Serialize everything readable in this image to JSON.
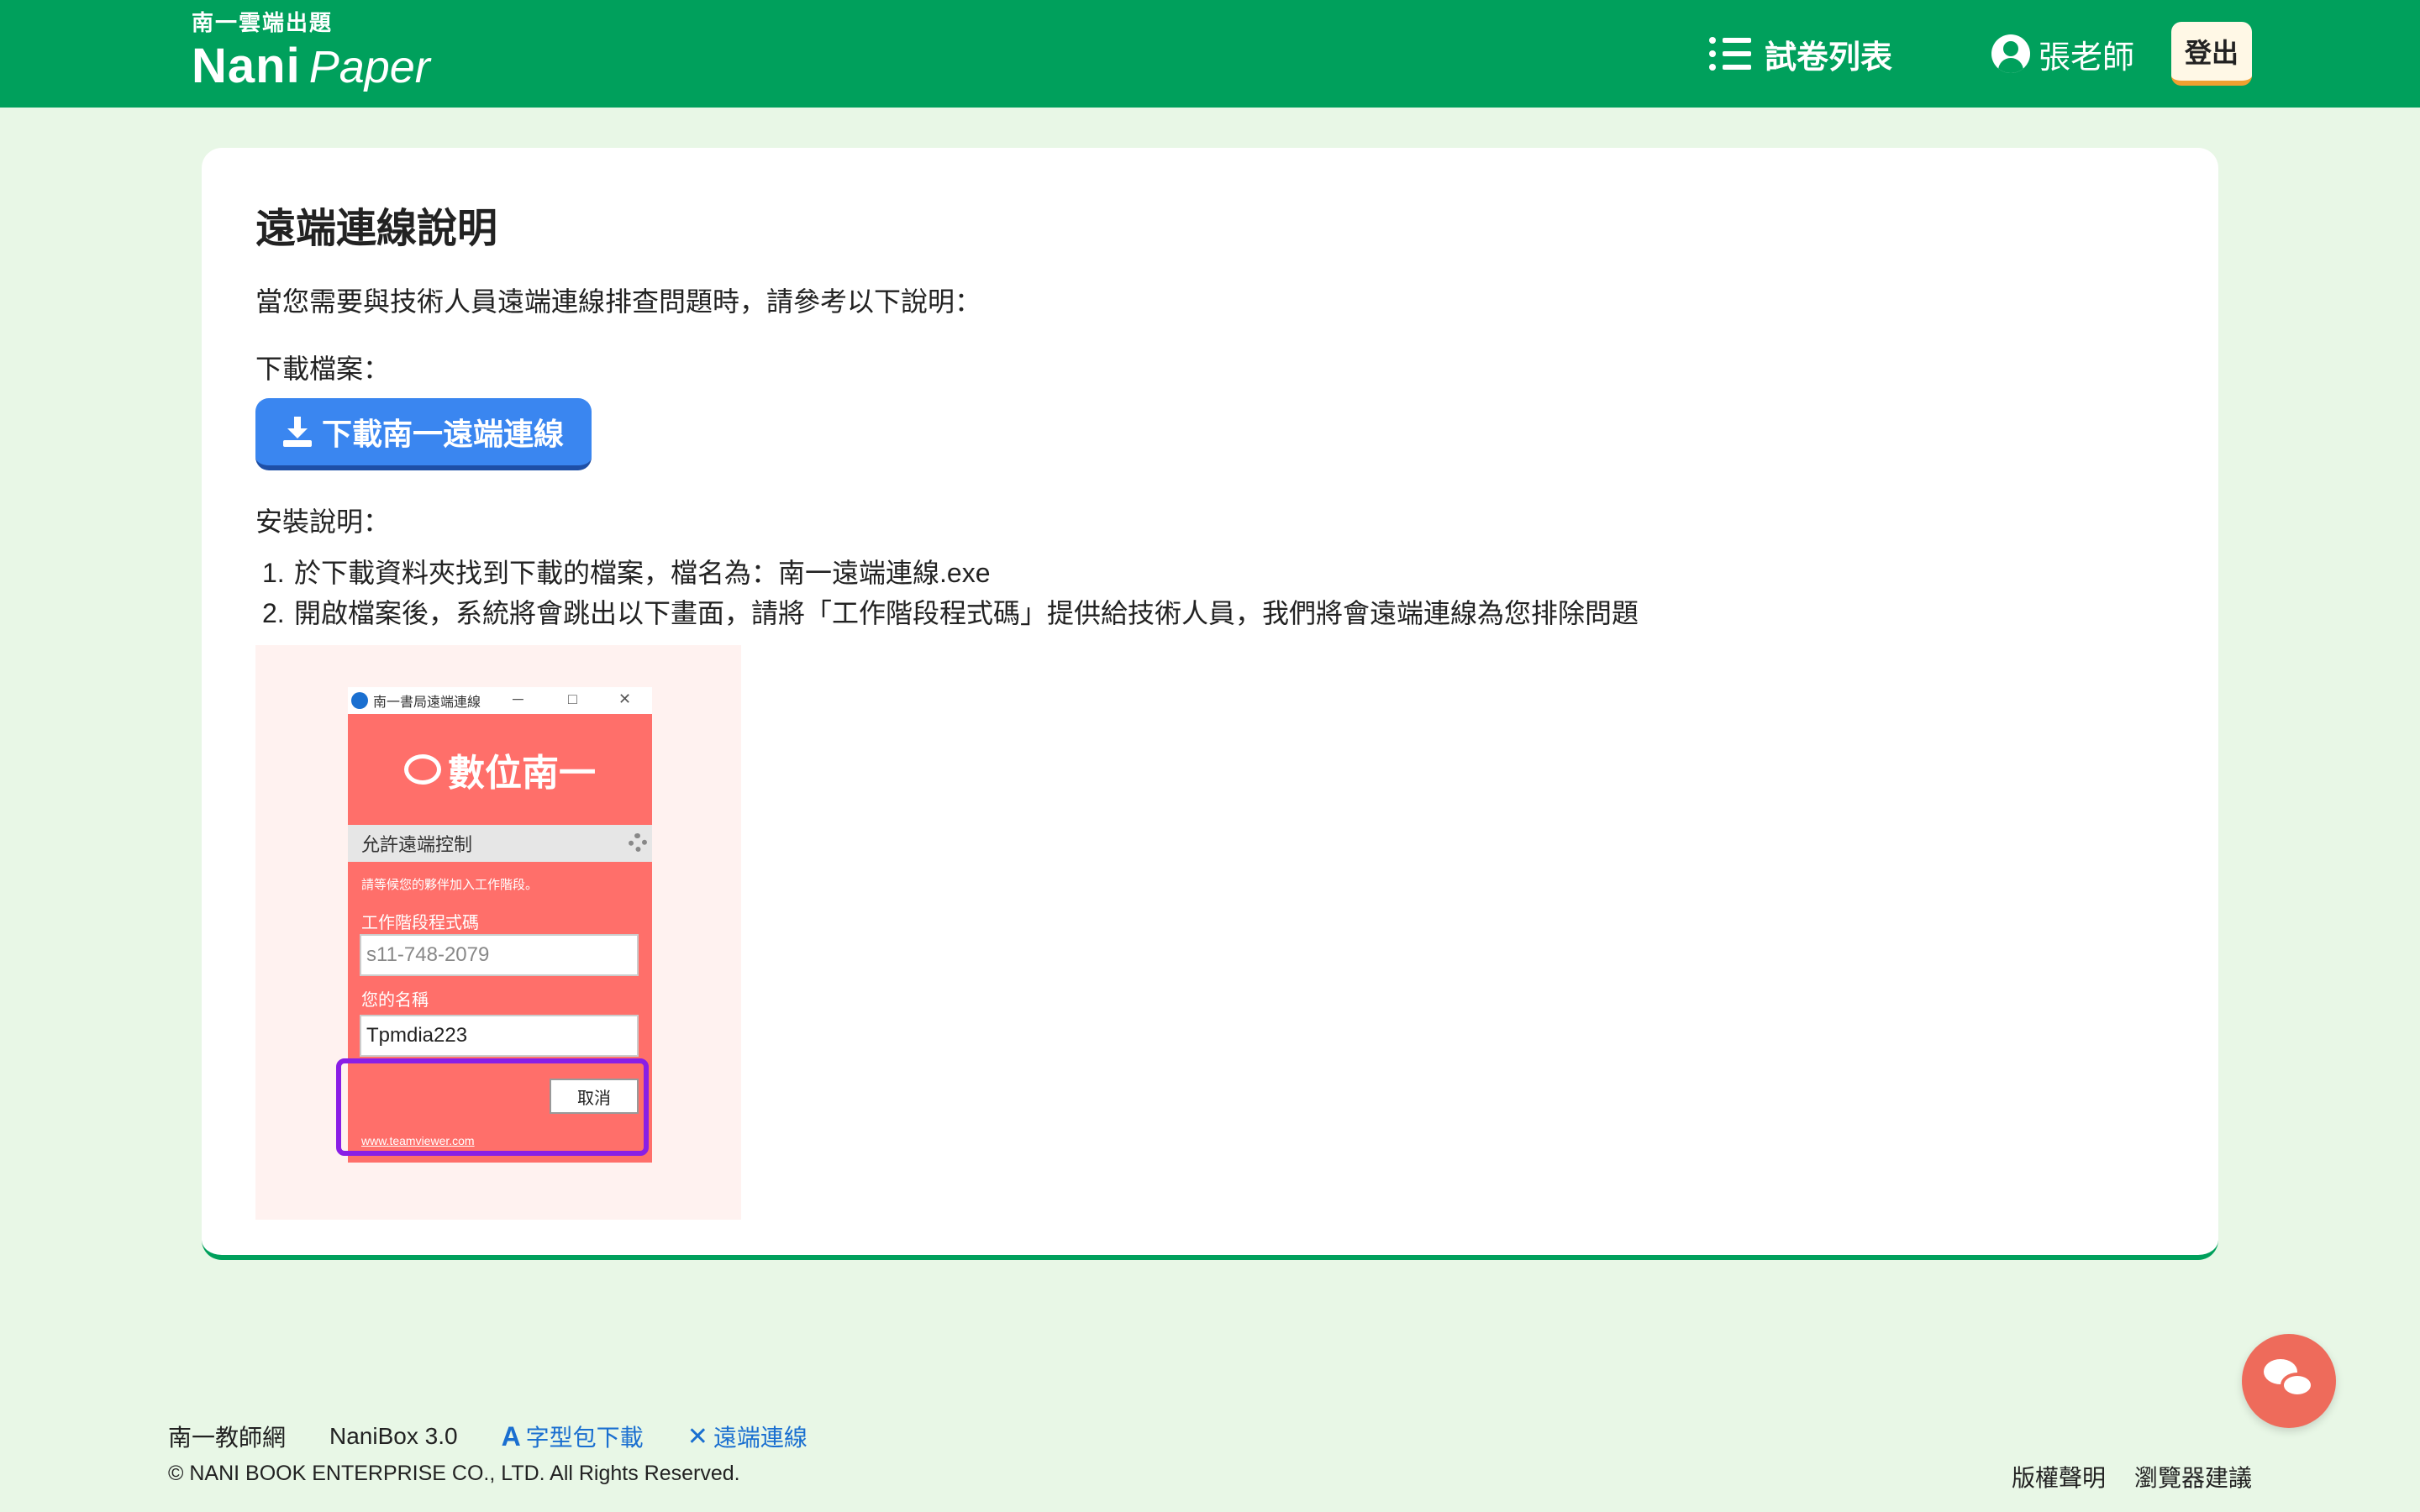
{
  "header": {
    "logo_sub": "南一雲端出題",
    "logo_nani": "Nani",
    "logo_paper": "Paper",
    "nav_list_label": "試卷列表",
    "user_name": "張老師",
    "logout_label": "登出",
    "brand_color": "#00a05c"
  },
  "main": {
    "title": "遠端連線說明",
    "intro": "當您需要與技術人員遠端連線排查問題時，請參考以下說明：",
    "download_label": "下載檔案：",
    "download_button": "下載南一遠端連線",
    "install_label": "安裝說明：",
    "steps": [
      {
        "num": "1.",
        "text": "於下載資料夾找到下載的檔案，檔名為：南一遠端連線.exe"
      },
      {
        "num": "2.",
        "text": "開啟檔案後，系統將會跳出以下畫面，請將「工作階段程式碼」提供給技術人員，我們將會遠端連線為您排除問題"
      }
    ],
    "button_color": "#3a86f0"
  },
  "screenshot": {
    "window_title": "南一書局遠端連線",
    "minimize": "─",
    "maximize": "□",
    "close": "✕",
    "brand": "數位南一",
    "allow_label": "允許遠端控制",
    "wait_text": "請等候您的夥伴加入工作階段。",
    "session_label": "工作階段程式碼",
    "session_code": "s11-748-2079",
    "name_label": "您的名稱",
    "name_value": "Tpmdia223",
    "cancel": "取消",
    "link": "www.teamviewer.com",
    "highlight_color": "#8a1ee6"
  },
  "footer": {
    "links": [
      "南一教師網",
      "NaniBox 3.0"
    ],
    "font_download": "字型包下載",
    "remote": "遠端連線",
    "copyright": "© NANI BOOK ENTERPRISE CO., LTD. All Rights Reserved.",
    "right_links": [
      "版權聲明",
      "瀏覽器建議"
    ]
  },
  "icons": {
    "list": "list-icon",
    "user": "user-circle-icon",
    "download": "download-icon",
    "chat": "chat-bubbles-icon",
    "font": "font-a-icon",
    "tools": "tools-icon"
  }
}
